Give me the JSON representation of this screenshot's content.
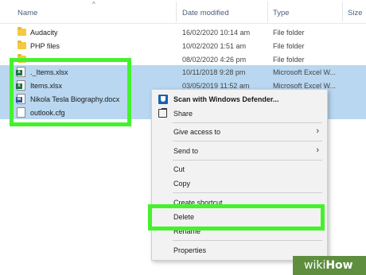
{
  "columns": {
    "name": "Name",
    "date_modified": "Date modified",
    "type": "Type",
    "size": "Size"
  },
  "rows": [
    {
      "name": "Audacity",
      "date": "16/02/2020 10:14 am",
      "type": "File folder",
      "icon": "folder-icon"
    },
    {
      "name": "PHP files",
      "date": "10/02/2020 1:51 am",
      "type": "File folder",
      "icon": "folder-icon"
    },
    {
      "name": "",
      "date": "08/02/2020 4:26 pm",
      "type": "File folder",
      "icon": "folder-icon"
    },
    {
      "name": "._Items.xlsx",
      "date": "10/11/2018 9:28 pm",
      "type": "Microsoft Excel W...",
      "icon": "excel-file-icon"
    },
    {
      "name": "Items.xlsx",
      "date": "03/05/2019 11:52 am",
      "type": "Microsoft Excel W...",
      "icon": "excel-file-icon"
    },
    {
      "name": "Nikola Tesla Biography.docx",
      "date": "",
      "type": "",
      "icon": "word-file-icon"
    },
    {
      "name": "outlook.cfg",
      "date": "",
      "type": "",
      "icon": "file-icon"
    }
  ],
  "context_menu": {
    "scan": "Scan with Windows Defender...",
    "share": "Share",
    "give_access": "Give access to",
    "send_to": "Send to",
    "cut": "Cut",
    "copy": "Copy",
    "create_shortcut": "Create shortcut",
    "delete": "Delete",
    "rename": "Rename",
    "properties": "Properties"
  },
  "watermark": {
    "wiki": "wiki",
    "how": "How"
  },
  "colors": {
    "highlight": "#44f22c",
    "selection": "#cce8ff",
    "watermark": "#5e8e3e"
  }
}
